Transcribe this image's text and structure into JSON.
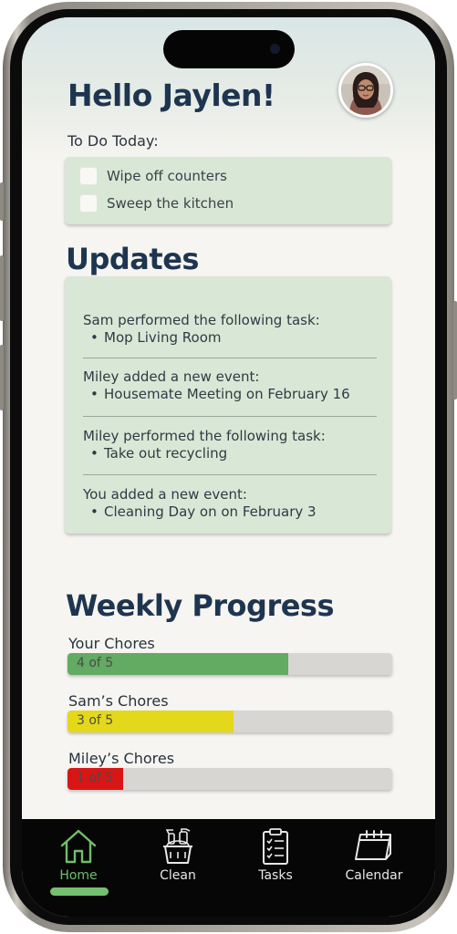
{
  "header": {
    "greeting": "Hello Jaylen!",
    "avatar_icon": "user-avatar-icon"
  },
  "todo": {
    "label": "To Do Today:",
    "items": [
      {
        "text": "Wipe off counters",
        "checked": false
      },
      {
        "text": "Sweep the kitchen",
        "checked": false
      }
    ]
  },
  "updates": {
    "title": "Updates",
    "items": [
      {
        "head": "Sam performed the following task:",
        "detail": "Mop Living Room"
      },
      {
        "head": "Miley added a new event:",
        "detail": "Housemate Meeting on February 16"
      },
      {
        "head": "Miley performed the following task:",
        "detail": "Take out recycling"
      },
      {
        "head": "You added a new event:",
        "detail": "Cleaning Day on on February 3"
      }
    ]
  },
  "progress": {
    "title": "Weekly Progress",
    "bars": [
      {
        "label": "Your Chores",
        "text": "4 of 5",
        "completed": 4,
        "total": 5,
        "color": "#63aa62"
      },
      {
        "label": "Sam’s Chores",
        "text": "3 of 5",
        "completed": 3,
        "total": 5,
        "color": "#e4d81a"
      },
      {
        "label": "Miley’s Chores",
        "text": "1 of 5",
        "completed": 1,
        "total": 5,
        "color": "#d81616"
      }
    ]
  },
  "tabbar": {
    "tabs": [
      {
        "label": "Home",
        "icon": "home-icon",
        "active": true
      },
      {
        "label": "Clean",
        "icon": "cleaning-bucket-icon",
        "active": false
      },
      {
        "label": "Tasks",
        "icon": "clipboard-checklist-icon",
        "active": false
      },
      {
        "label": "Calendar",
        "icon": "calendar-icon",
        "active": false
      }
    ]
  },
  "colors": {
    "accent": "#6fbf6a",
    "heading": "#1e3550",
    "card": "#d9e7d6"
  }
}
